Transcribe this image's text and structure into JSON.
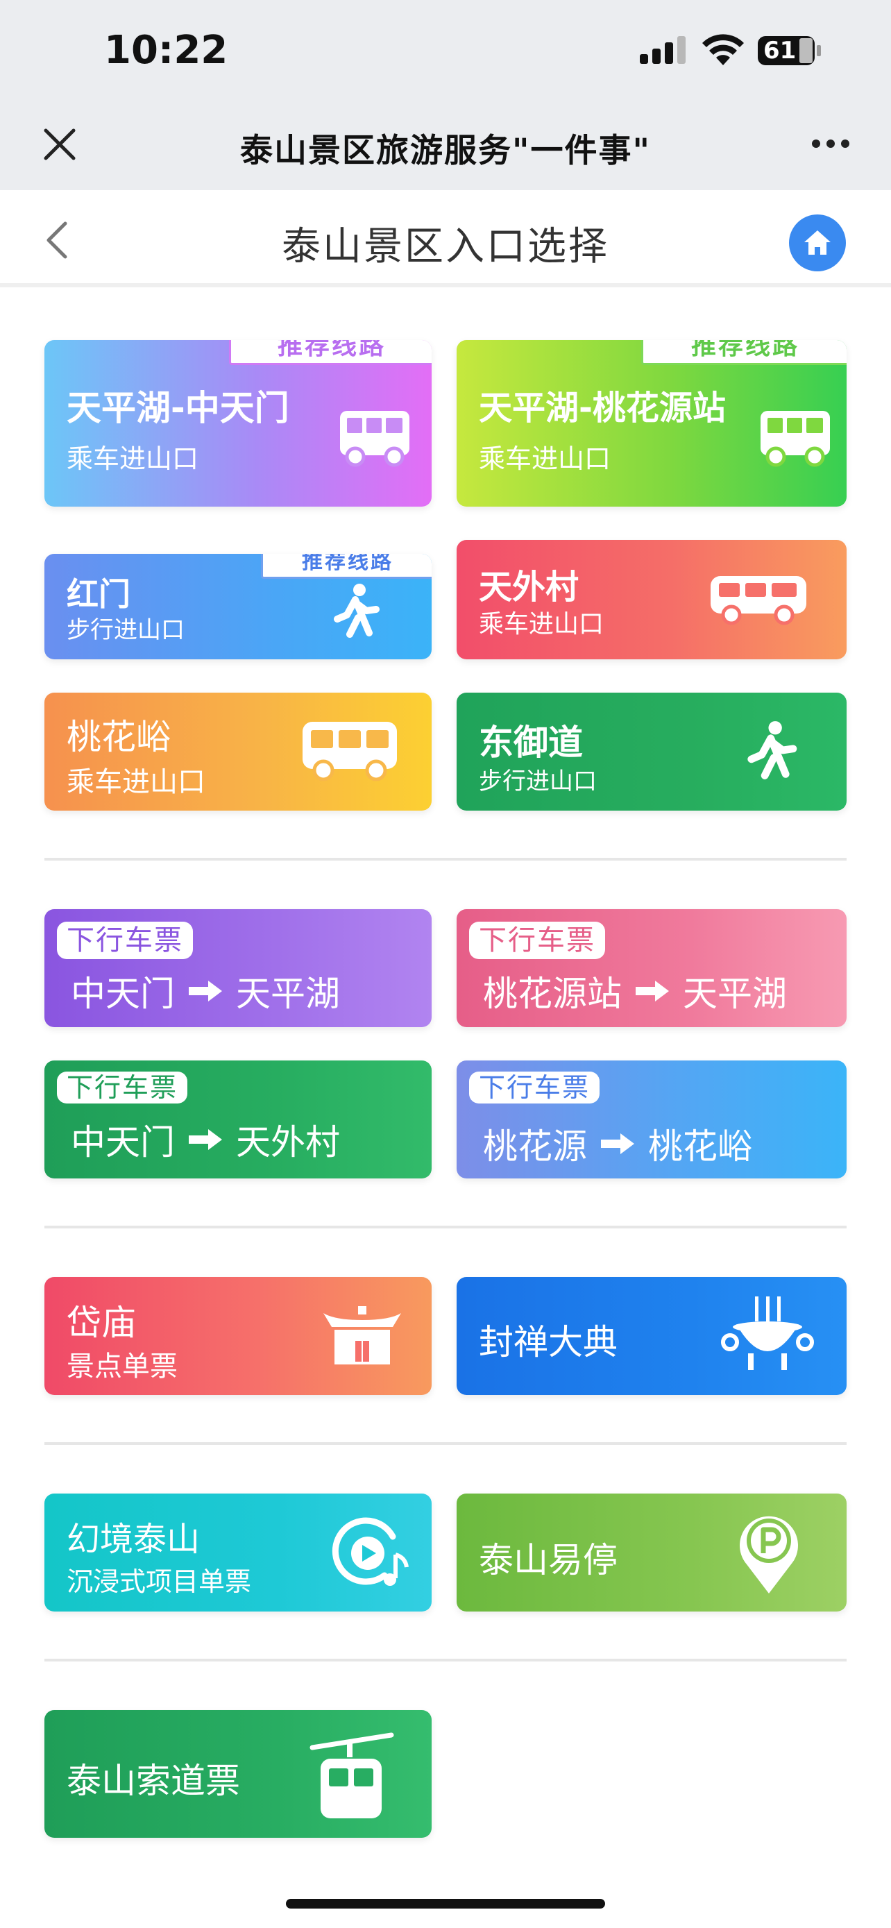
{
  "status_bar": {
    "time": "10:22",
    "battery": "61"
  },
  "mini_program": {
    "title": "泰山景区旅游服务\"一件事\""
  },
  "nav": {
    "title": "泰山景区入口选择"
  },
  "entrances": [
    {
      "name": "天平湖-中天门",
      "mode": "乘车进山口",
      "tag": "推荐线路",
      "icon": "bus-icon"
    },
    {
      "name": "天平湖-桃花源站",
      "mode": "乘车进山口",
      "tag": "推荐线路",
      "icon": "bus-icon"
    },
    {
      "name": "红门",
      "mode": "步行进山口",
      "tag": "推荐线路",
      "icon": "walking-person-icon"
    },
    {
      "name": "天外村",
      "mode": "乘车进山口",
      "icon": "bus-icon"
    },
    {
      "name": "桃花峪",
      "mode": "乘车进山口",
      "icon": "bus-icon"
    },
    {
      "name": "东御道",
      "mode": "步行进山口",
      "icon": "walking-person-icon"
    }
  ],
  "downhill_tickets": [
    {
      "tag": "下行车票",
      "from": "中天门",
      "to": "天平湖"
    },
    {
      "tag": "下行车票",
      "from": "桃花源站",
      "to": "天平湖"
    },
    {
      "tag": "下行车票",
      "from": "中天门",
      "to": "天外村"
    },
    {
      "tag": "下行车票",
      "from": "桃花源",
      "to": "桃花峪"
    }
  ],
  "attractions": [
    {
      "name": "岱庙",
      "sub": "景点单票",
      "icon": "temple-icon"
    },
    {
      "name": "封禅大典",
      "icon": "incense-burner-icon"
    }
  ],
  "services": [
    {
      "name": "幻境泰山",
      "sub": "沉浸式项目单票",
      "icon": "play-music-icon"
    },
    {
      "name": "泰山易停",
      "icon": "parking-pin-icon"
    }
  ],
  "cableway": {
    "name": "泰山索道票",
    "icon": "cable-car-icon"
  },
  "colors": {
    "accent_blue": "#3a8af0",
    "tag_purple": "#b86ef0",
    "tag_green": "#5fc94a",
    "tag_blue": "#4a7de8"
  }
}
